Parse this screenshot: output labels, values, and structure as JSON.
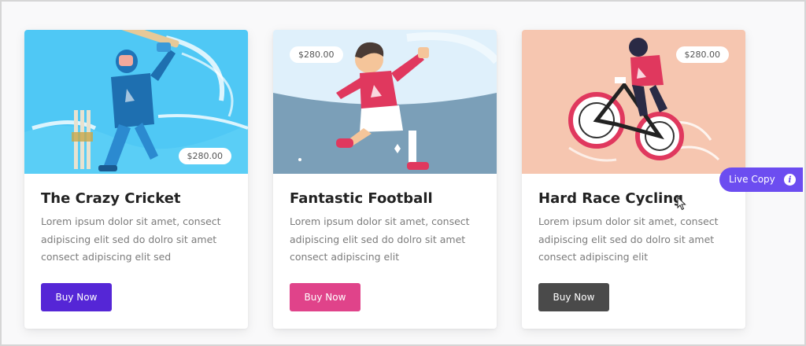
{
  "cards": [
    {
      "title": "The Crazy Cricket",
      "price": "$280.00",
      "description": "Lorem ipsum dolor sit amet, consect adipiscing elit sed do dolro sit amet consect adipiscing elit sed",
      "button_label": "Buy Now",
      "button_color": "#5526d6",
      "illustration_background": "#4fc8f5",
      "illustration_icon": "cricket-player-illustration"
    },
    {
      "title": "Fantastic Football",
      "price": "$280.00",
      "description": "Lorem ipsum dolor sit amet, consect adipiscing elit sed do dolro sit amet consect adipiscing elit",
      "button_label": "Buy Now",
      "button_color": "#e0438a",
      "illustration_background": "#7b9fb8",
      "illustration_icon": "football-player-illustration"
    },
    {
      "title": "Hard Race Cycling",
      "price": "$280.00",
      "description": "Lorem ipsum dolor sit amet, consect adipiscing elit sed do dolro sit amet consect adipiscing elit",
      "button_label": "Buy Now",
      "button_color": "#4a4a4a",
      "illustration_background": "#f6c6b0",
      "illustration_icon": "cyclist-illustration"
    }
  ],
  "live_copy": {
    "label": "Live Copy",
    "info_glyph": "i",
    "color": "#6c4df0"
  }
}
